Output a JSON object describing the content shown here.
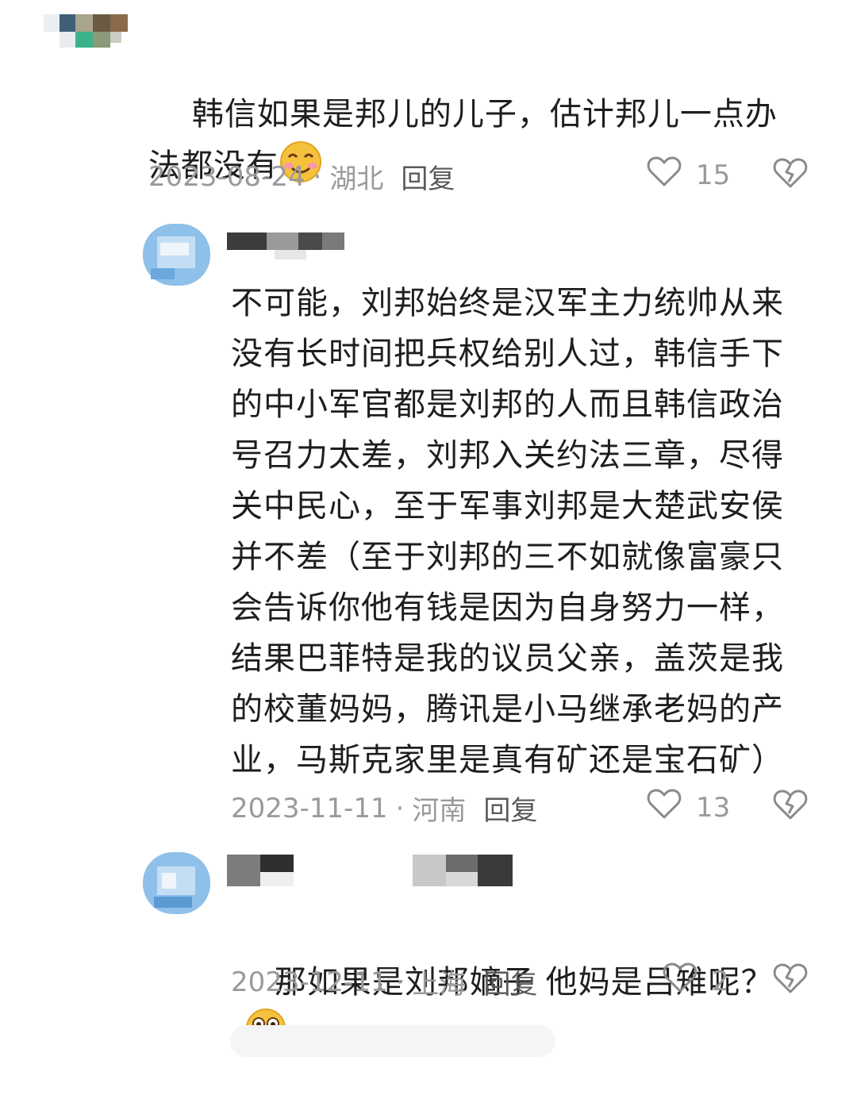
{
  "comments": [
    {
      "text_before": "韩信如果是邦儿的儿子，估计邦儿一点办法都没有",
      "emoji": "blushing-smile-emoji",
      "date": "2023-08-24",
      "sep": "·",
      "location": "湖北",
      "reply": "回复",
      "likes": "15"
    },
    {
      "text": "不可能，刘邦始终是汉军主力统帅从来没有长时间把兵权给别人过，韩信手下的中小军官都是刘邦的人而且韩信政治号召力太差，刘邦入关约法三章，尽得关中民心，至于军事刘邦是大楚武安侯并不差（至于刘邦的三不如就像富豪只会告诉你他有钱是因为自身努力一样，结果巴菲特是我的议员父亲，盖茨是我的校董妈妈，腾讯是小马继承老妈的产业，马斯克家里是真有矿还是宝石矿）",
      "date": "2023-11-11",
      "sep": "·",
      "location": "河南",
      "reply": "回复",
      "likes": "13"
    },
    {
      "text": "那如果是刘邦嫡子 他妈是吕雉呢？",
      "emoji": "grinning-hands-emoji",
      "date": "2023-12-11",
      "sep": "·",
      "location": "上海",
      "reply": "回复",
      "likes": "2"
    }
  ],
  "icons": {
    "like": "heart-outline-icon",
    "dislike": "broken-heart-icon"
  },
  "colors": {
    "text": "#1e1e1e",
    "meta": "#9a9a9a",
    "reply": "#5a5a5a",
    "emoji_face": "#f6c23e"
  }
}
